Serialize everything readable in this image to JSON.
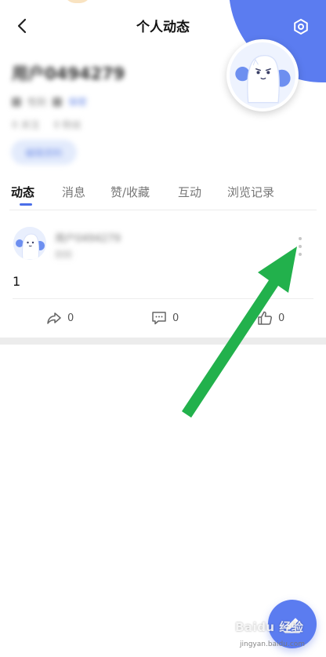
{
  "header": {
    "title": "个人动态",
    "back_icon": "chevron-left-icon",
    "settings_icon": "hexagon-settings-icon"
  },
  "profile": {
    "username": "用户0494279",
    "meta_labels": [
      "性别",
      "年龄"
    ],
    "meta_values": [
      "未知",
      "保密"
    ],
    "follow_stats": [
      "0 关注",
      "0 粉丝"
    ],
    "edit_button": "编辑资料",
    "avatar_icon": "mascot-avatar-icon"
  },
  "tabs": [
    {
      "label": "动态",
      "active": true
    },
    {
      "label": "消息",
      "active": false
    },
    {
      "label": "赞/收藏",
      "active": false
    },
    {
      "label": "互动",
      "active": false
    },
    {
      "label": "浏览记录",
      "active": false
    }
  ],
  "post": {
    "user": "用户0494279",
    "time": "刚刚",
    "text": "1",
    "more_icon": "more-vertical-icon",
    "actions": [
      {
        "icon": "share-icon",
        "count": "0"
      },
      {
        "icon": "comment-icon",
        "count": "0"
      },
      {
        "icon": "like-icon",
        "count": "0"
      }
    ]
  },
  "fab": {
    "icon": "pencil-icon"
  },
  "watermark": {
    "brand": "Baidu 经验",
    "url": "jingyan.baidu.com"
  },
  "colors": {
    "accent": "#5b7cf0",
    "tab_indicator": "#4a6ee8",
    "annotation_arrow": "#22b14c"
  }
}
